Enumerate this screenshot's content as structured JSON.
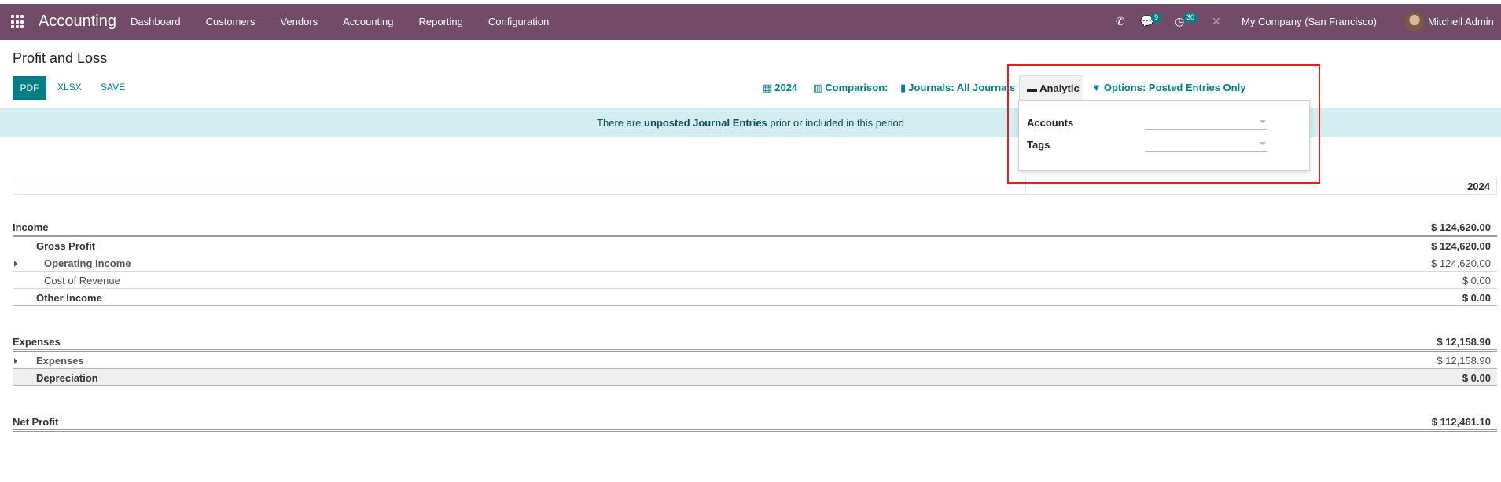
{
  "navbar": {
    "brand": "Accounting",
    "menu": [
      "Dashboard",
      "Customers",
      "Vendors",
      "Accounting",
      "Reporting",
      "Configuration"
    ],
    "icons": {
      "apps": "apps-grid-icon",
      "phone": "phone-icon",
      "chat": "chat-icon",
      "activity": "clock-icon",
      "debug": "tools-icon"
    },
    "phone_glyph": "✆",
    "chat_glyph": "💬",
    "activity_glyph": "◷",
    "debug_glyph": "✕",
    "chat_count": "9",
    "activity_count": "30",
    "company": "My Company (San Francisco)",
    "user": "Mitchell Admin"
  },
  "control_panel": {
    "title": "Profit and Loss",
    "buttons": {
      "pdf": "PDF",
      "xlsx": "XLSX",
      "save": "SAVE"
    },
    "filters": {
      "date_icon": "▦",
      "date": "2024",
      "comparison_icon": "▥",
      "comparison": "Comparison:",
      "journals_icon": "▮",
      "journals": "Journals: All Journals",
      "analytic_icon": "▬",
      "analytic": "Analytic",
      "options_icon": "▼",
      "options": "Options: Posted Entries Only"
    }
  },
  "analytic_dropdown": {
    "accounts_label": "Accounts",
    "tags_label": "Tags"
  },
  "alert": {
    "prefix": "There are ",
    "link": "unposted Journal Entries",
    "suffix": " prior or included in this period"
  },
  "report": {
    "column_header": "2024",
    "rows": [
      {
        "label": "Income",
        "value": "$ 124,620.00"
      },
      {
        "label": "Gross Profit",
        "value": "$ 124,620.00"
      },
      {
        "label": "Operating Income",
        "value": "$ 124,620.00"
      },
      {
        "label": "Cost of Revenue",
        "value": "$ 0.00"
      },
      {
        "label": "Other Income",
        "value": "$ 0.00"
      },
      {
        "label": "Expenses",
        "value": "$ 12,158.90"
      },
      {
        "label": "Expenses",
        "value": "$ 12,158.90"
      },
      {
        "label": "Depreciation",
        "value": "$ 0.00"
      },
      {
        "label": "Net Profit",
        "value": "$ 112,461.10"
      }
    ]
  },
  "colors": {
    "navbar": "#714b67",
    "primary": "#017e84",
    "alert_bg": "#d3edf1",
    "highlight": "#e31e24"
  }
}
